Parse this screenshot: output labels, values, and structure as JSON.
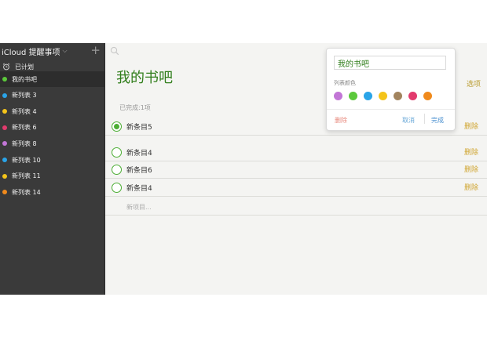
{
  "sidebar": {
    "title": "iCloud 提醒事项",
    "chevron": "⌵",
    "add": "+",
    "scheduled": "已计划",
    "items": [
      {
        "label": "我的书吧",
        "color": "#5cc93b"
      },
      {
        "label": "新列表 3",
        "color": "#2aa4e8"
      },
      {
        "label": "新列表 4",
        "color": "#f4c41a"
      },
      {
        "label": "新列表 6",
        "color": "#e23a6d"
      },
      {
        "label": "新列表 8",
        "color": "#c276d6"
      },
      {
        "label": "新列表 10",
        "color": "#2aa4e8"
      },
      {
        "label": "新列表 11",
        "color": "#f4c41a"
      },
      {
        "label": "新列表 14",
        "color": "#f08a1c"
      }
    ]
  },
  "main": {
    "title": "我的书吧",
    "options": "选项",
    "completed": "已完成:1项",
    "rows": [
      {
        "label": "新条目5",
        "delete": "删除",
        "done": true
      },
      {
        "label": "新条目4",
        "delete": "删除",
        "done": false
      },
      {
        "label": "新条目6",
        "delete": "删除",
        "done": false
      },
      {
        "label": "新条目4",
        "delete": "删除",
        "done": false
      }
    ],
    "new_item": "新项目..."
  },
  "popover": {
    "name_value": "我的书吧",
    "caption": "列表颜色",
    "swatches": [
      "#c276d6",
      "#5cc93b",
      "#2aa4e8",
      "#f4c41a",
      "#a2845e",
      "#e23a6d",
      "#f08a1c"
    ],
    "delete": "删除",
    "cancel": "取消",
    "done": "完成"
  }
}
